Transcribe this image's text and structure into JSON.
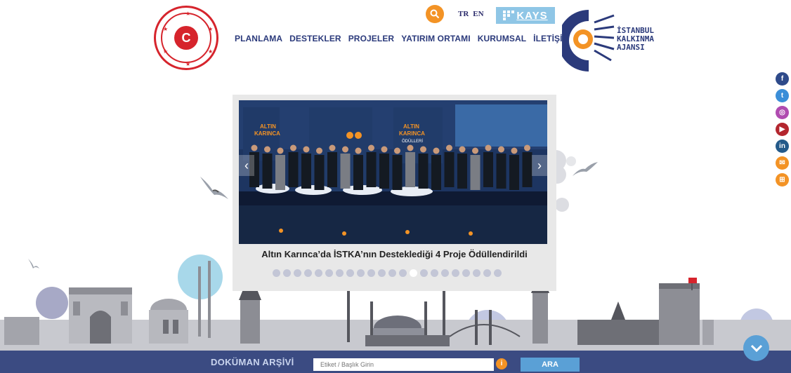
{
  "header": {
    "ministry_logo_letter": "C",
    "nav": [
      "PLANLAMA",
      "DESTEKLER",
      "PROJELER",
      "YATIRIM ORTAMI",
      "KURUMSAL",
      "İLETİŞİM"
    ],
    "languages": [
      "TR",
      "EN"
    ],
    "kays_label": "KAYS",
    "agency_logo_text": [
      "İSTANBUL",
      "KALKINMA",
      "AJANSI"
    ]
  },
  "social": [
    {
      "icon": "facebook-icon",
      "glyph": "f",
      "color": "#2e4a8a"
    },
    {
      "icon": "twitter-icon",
      "glyph": "t",
      "color": "#3b8ed8"
    },
    {
      "icon": "instagram-icon",
      "glyph": "◎",
      "color": "#b04bb0"
    },
    {
      "icon": "youtube-icon",
      "glyph": "▶",
      "color": "#b3262e"
    },
    {
      "icon": "linkedin-icon",
      "glyph": "in",
      "color": "#245a8a"
    },
    {
      "icon": "mail-icon",
      "glyph": "✉",
      "color": "#f39325"
    },
    {
      "icon": "rss-icon",
      "glyph": "⊞",
      "color": "#f39325"
    }
  ],
  "slider": {
    "caption": "Altın Karınca’da İSTKA’nın Desteklediği 4 Proje Ödüllendirildi",
    "dot_count": 22,
    "active_dot": 13,
    "banner_text": [
      "ALTIN",
      "KARINCA",
      "ÖDÜLLERİ"
    ]
  },
  "document_archive": {
    "title": "DOKÜMAN ARŞİVİ",
    "placeholder": "Etiket / Başlık Girin",
    "search_label": "ARA"
  },
  "colors": {
    "nav_text": "#2b3a7b",
    "accent_orange": "#f39325",
    "bar_navy": "#3b4b82",
    "button_blue": "#5aa0d6",
    "ministry_red": "#d6242c"
  }
}
